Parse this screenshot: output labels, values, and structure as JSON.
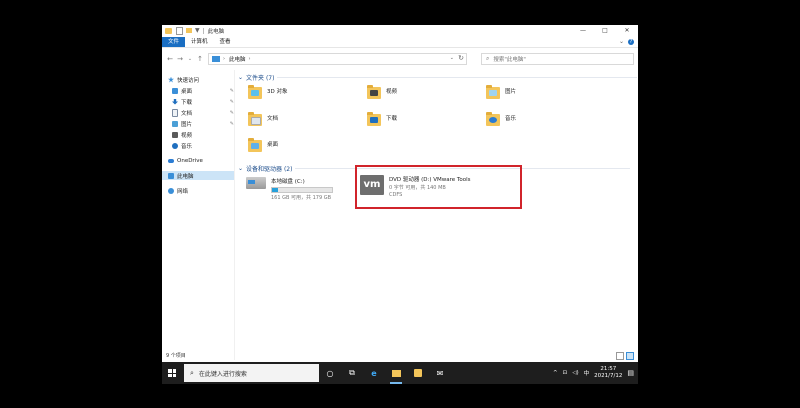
{
  "window": {
    "title": "此电脑",
    "quick_access_glyphs": [
      "▼"
    ],
    "caption": {
      "minimize": "—",
      "maximize": "□",
      "close": "✕"
    }
  },
  "ribbon": {
    "tabs": [
      "文件",
      "计算机",
      "查看"
    ],
    "expand_glyph": "⌄",
    "help_glyph": "?"
  },
  "nav": {
    "back": "←",
    "forward": "→",
    "recent": "⌄",
    "up": "↑",
    "path": [
      "此电脑"
    ],
    "path_chevron": "›",
    "dropdown": "⌄",
    "refresh": "↻",
    "search_placeholder": "搜索\"此电脑\""
  },
  "sidebar": {
    "items": [
      {
        "label": "快速访问",
        "icon": "star-icon",
        "color": "#3a8fd8",
        "pinned": false
      },
      {
        "label": "桌面",
        "icon": "desktop-icon",
        "color": "#3a8fd8",
        "pinned": true
      },
      {
        "label": "下载",
        "icon": "download-icon",
        "color": "#1f6fbf",
        "pinned": true
      },
      {
        "label": "文档",
        "icon": "document-icon",
        "color": "#7a8aa0",
        "pinned": true
      },
      {
        "label": "图片",
        "icon": "picture-icon",
        "color": "#4b9fd6",
        "pinned": true
      },
      {
        "label": "视频",
        "icon": "video-icon",
        "color": "#5a5a5a",
        "pinned": false
      },
      {
        "label": "音乐",
        "icon": "music-icon",
        "color": "#1f6fbf",
        "pinned": false
      },
      {
        "label": "OneDrive",
        "icon": "cloud-icon",
        "color": "#2b7cd3",
        "pinned": false
      },
      {
        "label": "此电脑",
        "icon": "computer-icon",
        "color": "#3a8fd8",
        "pinned": false,
        "selected": true
      },
      {
        "label": "网络",
        "icon": "network-icon",
        "color": "#3a8fd8",
        "pinned": false
      }
    ],
    "pin_glyph": "✎"
  },
  "content": {
    "folders_header": "文件夹 (7)",
    "folders": [
      {
        "label": "3D 对象",
        "badge_color": "#5bc0eb"
      },
      {
        "label": "视频",
        "badge_color": "#444444"
      },
      {
        "label": "图片",
        "badge_color": "#9fd3f0"
      },
      {
        "label": "文档",
        "badge_color": "#dfe6ee"
      },
      {
        "label": "下载",
        "badge_color": "#1f6fbf"
      },
      {
        "label": "音乐",
        "badge_color": "#2b7cd3"
      },
      {
        "label": "桌面",
        "badge_color": "#5fb0e8"
      }
    ],
    "devices_header": "设备和驱动器 (2)",
    "drives": [
      {
        "label": "本地磁盘 (C:)",
        "free_text": "161 GB 可用，共 179 GB",
        "used_fraction": 0.1
      },
      {
        "label": "DVD 驱动器 (D:) VMware Tools",
        "free_text": "0 字节 可用，共 140 MB",
        "fs": "CDFS",
        "logo": "vm"
      }
    ]
  },
  "status": {
    "text": "9 个项目"
  },
  "taskbar": {
    "search_placeholder": "在此键入进行搜索",
    "apps": [
      {
        "name": "cortana-icon",
        "glyph": "○"
      },
      {
        "name": "task-view-icon",
        "glyph": "⧉"
      },
      {
        "name": "edge-icon",
        "glyph": "e"
      },
      {
        "name": "file-explorer-icon",
        "glyph": "▬",
        "active": true
      },
      {
        "name": "store-icon",
        "glyph": "⌂"
      },
      {
        "name": "mail-icon",
        "glyph": "✉"
      }
    ],
    "tray": {
      "up": "^",
      "network": "⊡",
      "volume": "◁)",
      "ime": "中",
      "time": "21:57",
      "date": "2021/7/12",
      "notify": "▤"
    }
  },
  "colors": {
    "accent": "#1a6ec2",
    "highlight_box": "#d1242b",
    "folder": "#f3c55a"
  }
}
